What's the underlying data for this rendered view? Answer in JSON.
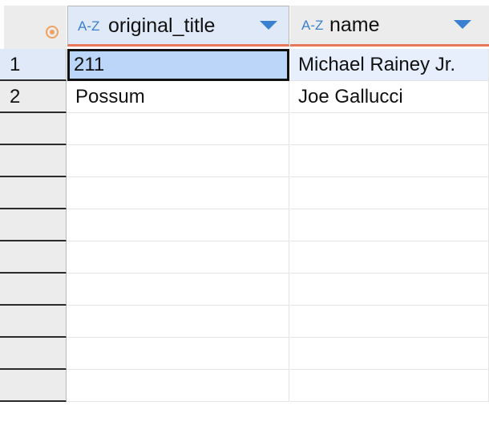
{
  "table": {
    "columns": [
      {
        "type_icon": "A-Z",
        "label": "original_title",
        "sort_icon": "chevron-down-icon"
      },
      {
        "type_icon": "A-Z",
        "label": "name",
        "sort_icon": "chevron-down-icon"
      }
    ],
    "rows": [
      {
        "num": "1",
        "cells": [
          "211",
          "Michael Rainey Jr."
        ]
      },
      {
        "num": "2",
        "cells": [
          "Possum",
          "Joe Gallucci"
        ]
      },
      {
        "num": "",
        "cells": [
          "",
          ""
        ]
      },
      {
        "num": "",
        "cells": [
          "",
          ""
        ]
      },
      {
        "num": "",
        "cells": [
          "",
          ""
        ]
      },
      {
        "num": "",
        "cells": [
          "",
          ""
        ]
      },
      {
        "num": "",
        "cells": [
          "",
          ""
        ]
      },
      {
        "num": "",
        "cells": [
          "",
          ""
        ]
      },
      {
        "num": "",
        "cells": [
          "",
          ""
        ]
      },
      {
        "num": "",
        "cells": [
          "",
          ""
        ]
      },
      {
        "num": "",
        "cells": [
          "",
          ""
        ]
      }
    ]
  },
  "colors": {
    "accent": "#3b7fd0",
    "header_underline": "#e8775a",
    "selected_cell": "#bcd6f9",
    "selected_row": "#e6effb",
    "corner_icon": "#f0a060"
  }
}
